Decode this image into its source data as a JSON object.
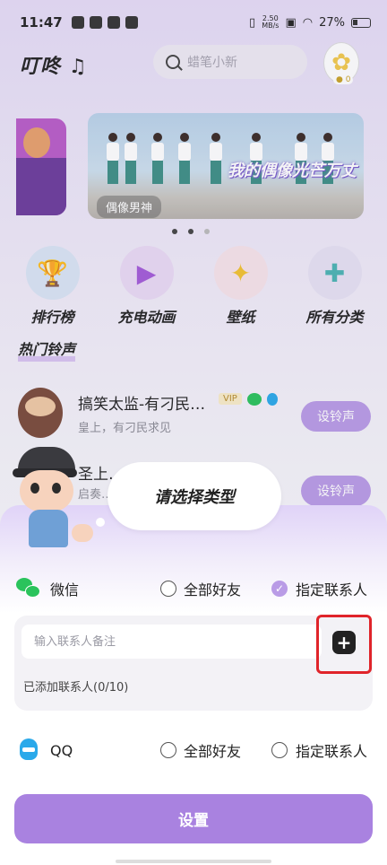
{
  "status_bar": {
    "time": "11:47",
    "net_speed_top": "2.50",
    "net_speed_bottom": "MB/s",
    "battery": "27%"
  },
  "header": {
    "logo": "叮咚",
    "search_placeholder": "蜡笔小新",
    "coins": "0"
  },
  "banner": {
    "title": "我的偶像光芒万丈",
    "tag": "偶像男神",
    "active_dot": 1,
    "dot_count": 3
  },
  "categories": [
    {
      "label": "排行榜",
      "icon": "trophy-icon",
      "color": "#d9e4f5"
    },
    {
      "label": "充电动画",
      "icon": "play-icon",
      "color": "#ead9f5"
    },
    {
      "label": "壁纸",
      "icon": "sparkle-icon",
      "color": "#f7e3ea"
    },
    {
      "label": "所有分类",
      "icon": "puzzle-icon",
      "color": "#e6e1f3"
    }
  ],
  "section_title": "热门铃声",
  "ringtones": [
    {
      "title": "搞笑太监-有刁民…",
      "subtitle": "皇上，有刁民求见",
      "badge": "VIP",
      "button": "设铃声"
    },
    {
      "title": "圣上…",
      "subtitle": "启奏…",
      "button": "设铃声"
    }
  ],
  "sheet": {
    "title": "请选择类型",
    "wechat": {
      "name": "微信",
      "opt_all": "全部好友",
      "opt_specific": "指定联系人",
      "selected": "specific"
    },
    "contact": {
      "placeholder": "输入联系人备注",
      "value": "",
      "add_label": "+",
      "count_text": "已添加联系人(0/10)"
    },
    "qq": {
      "name": "QQ",
      "opt_all": "全部好友",
      "opt_specific": "指定联系人",
      "selected": ""
    },
    "submit": "设置"
  }
}
